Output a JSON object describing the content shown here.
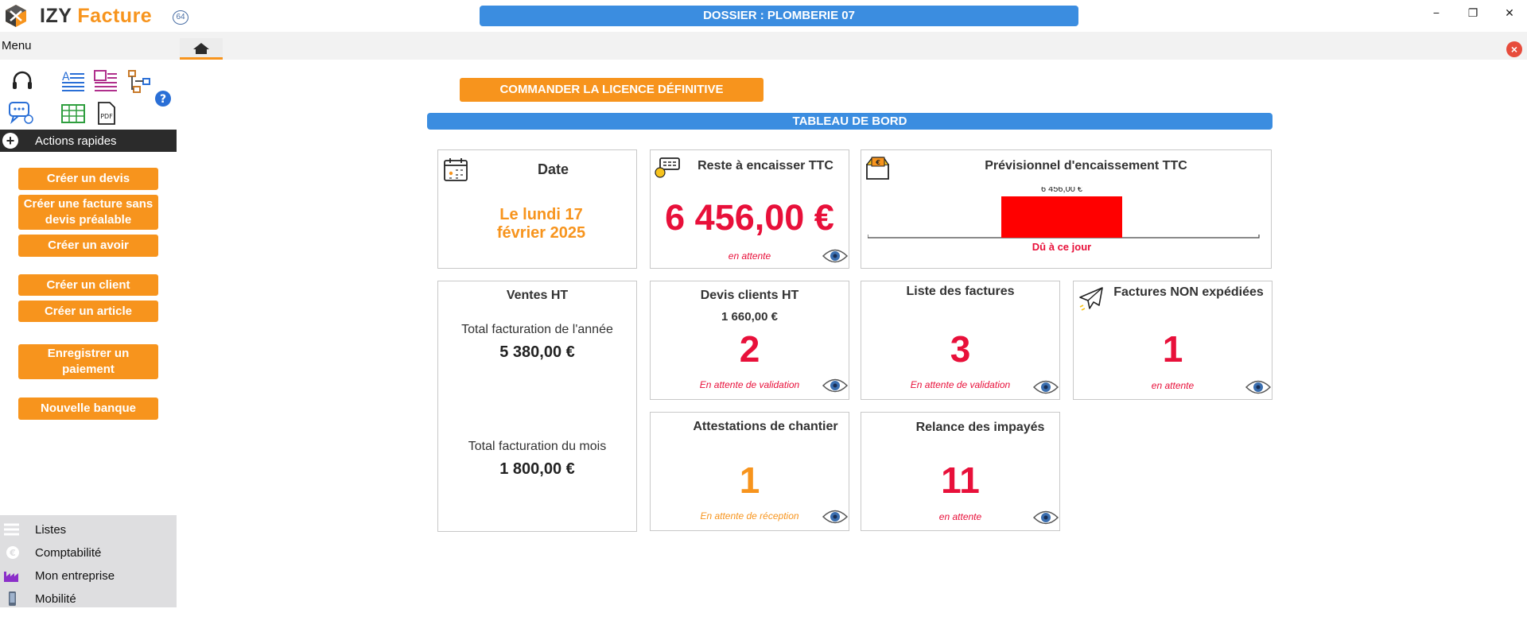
{
  "app": {
    "name_part1": "IZY",
    "name_part2": "Facture",
    "badge": "64",
    "dossier": "DOSSIER : PLOMBERIE 07"
  },
  "window_controls": {
    "minimize": "−",
    "restore": "❐",
    "close": "✕"
  },
  "menu": {
    "label": "Menu"
  },
  "sidebar": {
    "actions_header": "Actions rapides",
    "buttons": [
      "Créer un devis",
      "Créer une facture sans devis préalable",
      "Créer un avoir",
      "Créer un client",
      "Créer un article",
      "Enregistrer un paiement",
      "Nouvelle banque"
    ],
    "bottom_items": [
      "Listes",
      "Comptabilité",
      "Mon entreprise",
      "Mobilité"
    ]
  },
  "main": {
    "order_button": "COMMANDER LA LICENCE DÉFINITIVE",
    "dashboard_title": "TABLEAU DE BORD",
    "cards": {
      "date": {
        "title": "Date",
        "value": "Le lundi 17 février 2025"
      },
      "reste": {
        "title": "Reste à encaisser TTC",
        "value": "6 456,00 €",
        "status": "en attente"
      },
      "previsionnel": {
        "title": "Prévisionnel d'encaissement TTC"
      },
      "ventes": {
        "title": "Ventes HT",
        "year_label": "Total facturation de l'année",
        "year_value": "5 380,00 €",
        "month_label": "Total facturation du mois",
        "month_value": "1 800,00 €"
      },
      "devis": {
        "title": "Devis clients HT",
        "amount": "1 660,00 €",
        "count": "2",
        "status": "En attente de validation"
      },
      "factures": {
        "title": "Liste des factures",
        "count": "3",
        "status": "En attente de validation"
      },
      "non_expediees": {
        "title": "Factures NON expédiées",
        "count": "1",
        "status": "en attente"
      },
      "attestations": {
        "title": "Attestations de chantier",
        "count": "1",
        "status": "En attente de réception"
      },
      "relance": {
        "title": "Relance des impayés",
        "count": "11",
        "status": "en attente"
      }
    }
  },
  "chart_data": {
    "type": "bar",
    "categories": [
      "Dû à ce jour"
    ],
    "values": [
      6456
    ],
    "data_labels": [
      "6 456,00 €"
    ],
    "bar_color": "#ff0000",
    "label_color": "#e8103a"
  },
  "colors": {
    "accent_orange": "#f7941d",
    "accent_blue": "#3b8de0",
    "alert_red": "#e8103a"
  }
}
